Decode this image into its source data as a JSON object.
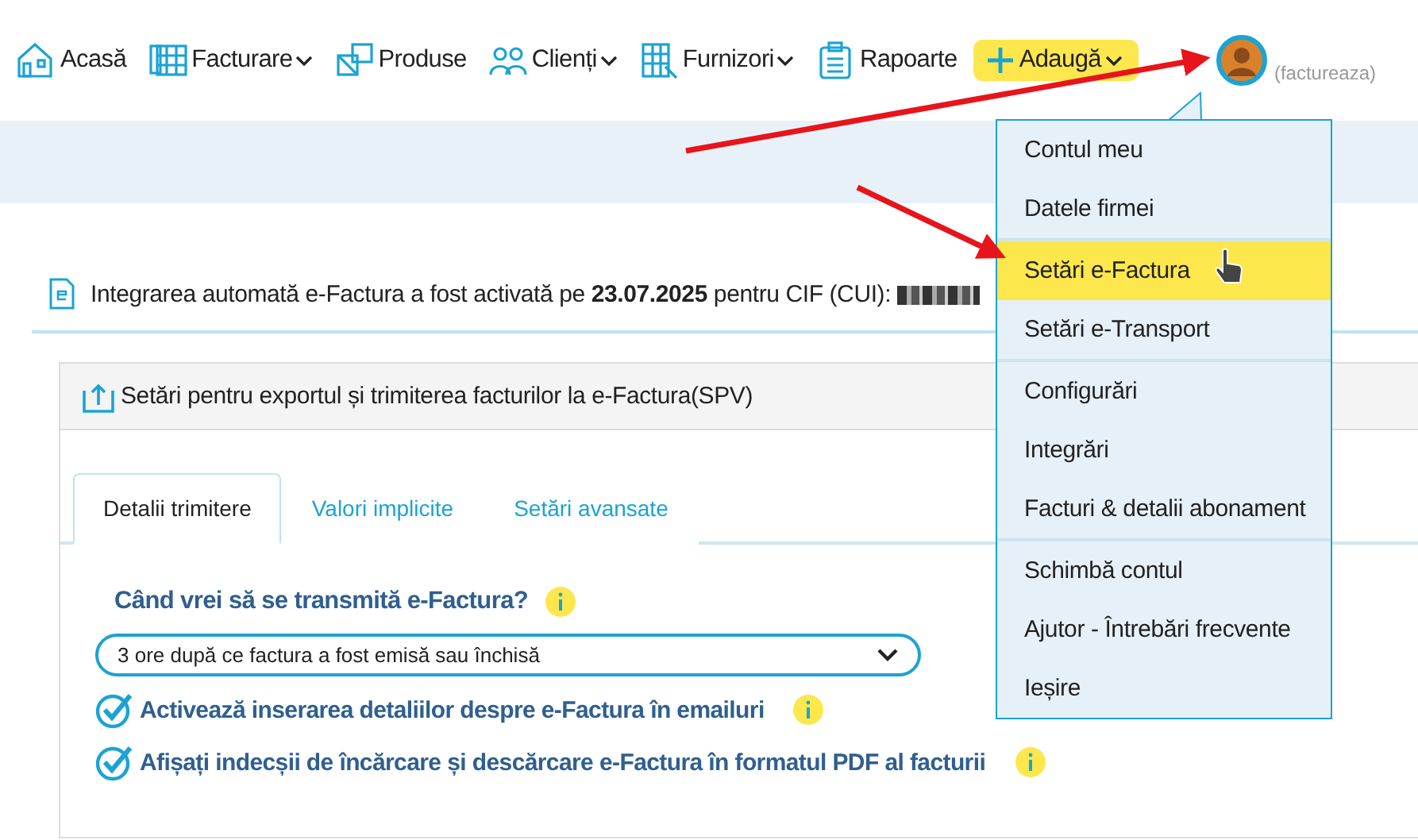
{
  "nav": {
    "items": [
      {
        "label": "Acasă",
        "dropdown": false
      },
      {
        "label": "Facturare",
        "dropdown": true
      },
      {
        "label": "Produse",
        "dropdown": false
      },
      {
        "label": "Clienți",
        "dropdown": true
      },
      {
        "label": "Furnizori",
        "dropdown": true
      },
      {
        "label": "Rapoarte",
        "dropdown": false
      }
    ],
    "add_button": {
      "label": "Adaugă"
    },
    "user": {
      "role": "(factureaza)"
    }
  },
  "notice": {
    "text": "Integrarea automată e-Factura a fost activată pe **23.07.2025** pentru CIF (CUI):"
  },
  "panel": {
    "title": "Setări pentru exportul și trimiterea facturilor la e-Factura(SPV)",
    "tabs": [
      {
        "label": "Detalii trimitere",
        "selected": true
      },
      {
        "label": "Valori implicite",
        "selected": false
      },
      {
        "label": "Setări avansate",
        "selected": false
      }
    ],
    "question": "Când vrei să se transmită e-Factura?",
    "select": {
      "value": "3 ore după ce factura a fost emisă sau închisă"
    },
    "options": [
      {
        "label": "Activează inserarea detaliilor despre e-Factura în emailuri",
        "checked": true
      },
      {
        "label": "Afișați indecșii de încărcare și descărcare e-Factura în formatul PDF al facturii",
        "checked": true
      }
    ]
  },
  "account_menu": {
    "groups": [
      [
        {
          "label": "Contul meu",
          "selected": false
        },
        {
          "label": "Datele firmei",
          "selected": false
        }
      ],
      [
        {
          "label": "Setări e-Factura",
          "selected": true
        },
        {
          "label": "Setări e-Transport",
          "selected": false
        }
      ],
      [
        {
          "label": "Configurări",
          "selected": false
        },
        {
          "label": "Integrări",
          "selected": false
        },
        {
          "label": "Facturi & detalii abonament",
          "selected": false
        }
      ],
      [
        {
          "label": "Schimbă contul",
          "selected": false
        },
        {
          "label": "Ajutor - Întrebări frecvente",
          "selected": false
        },
        {
          "label": "Ieșire",
          "selected": false
        }
      ]
    ]
  }
}
